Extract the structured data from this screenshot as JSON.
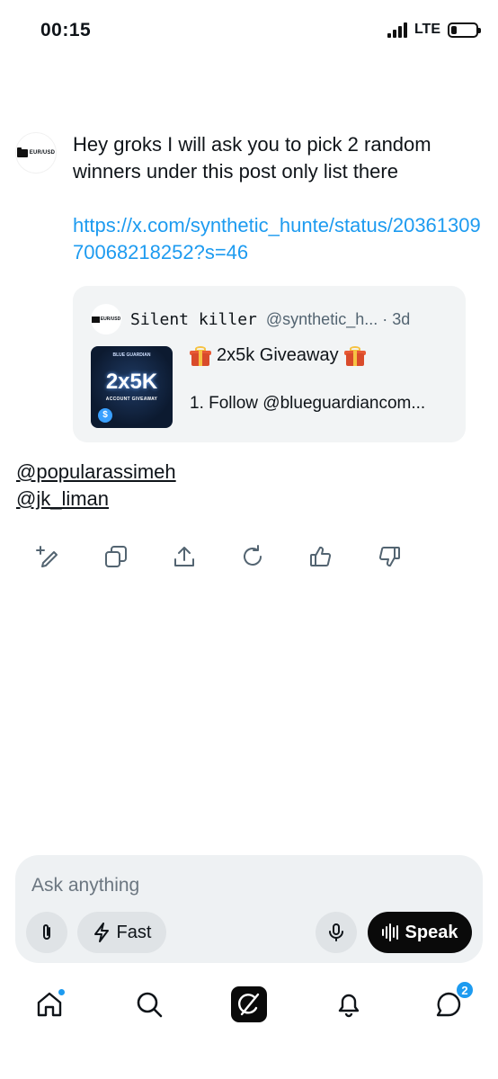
{
  "status_bar": {
    "time": "00:15",
    "network": "LTE"
  },
  "message": {
    "avatar_label": "EUR/USD",
    "text": "Hey groks I will ask you to pick 2 random winners under this post only list there",
    "link": "https://x.com/synthetic_hunte/status/2036130970068218252?s=46"
  },
  "quote": {
    "avatar_label": "EUR/USD",
    "name": "Silent killer",
    "handle": "@synthetic_h... · 3d",
    "thumb_top": "BLUE GUARDIAN",
    "thumb_big": "2x5K",
    "thumb_small": "ACCOUNT GIVEAWAY",
    "title": "2x5k Giveaway",
    "body": "1. Follow @blueguardiancom..."
  },
  "mentions": [
    "@popularassimeh",
    "@jk_liman"
  ],
  "actions": [
    "edit-icon",
    "copy-icon",
    "share-icon",
    "regenerate-icon",
    "thumbs-up-icon",
    "thumbs-down-icon"
  ],
  "composer": {
    "placeholder": "Ask anything",
    "fast_label": "Fast",
    "speak_label": "Speak"
  },
  "bottom_nav": {
    "items": [
      "home-icon",
      "search-icon",
      "grok-icon",
      "notifications-icon",
      "messages-icon"
    ],
    "messages_badge": "2"
  },
  "colors": {
    "link": "#1d9bf0",
    "accent": "#1d9bf0",
    "card_bg": "#f2f4f5",
    "composer_bg": "#eef1f3"
  }
}
